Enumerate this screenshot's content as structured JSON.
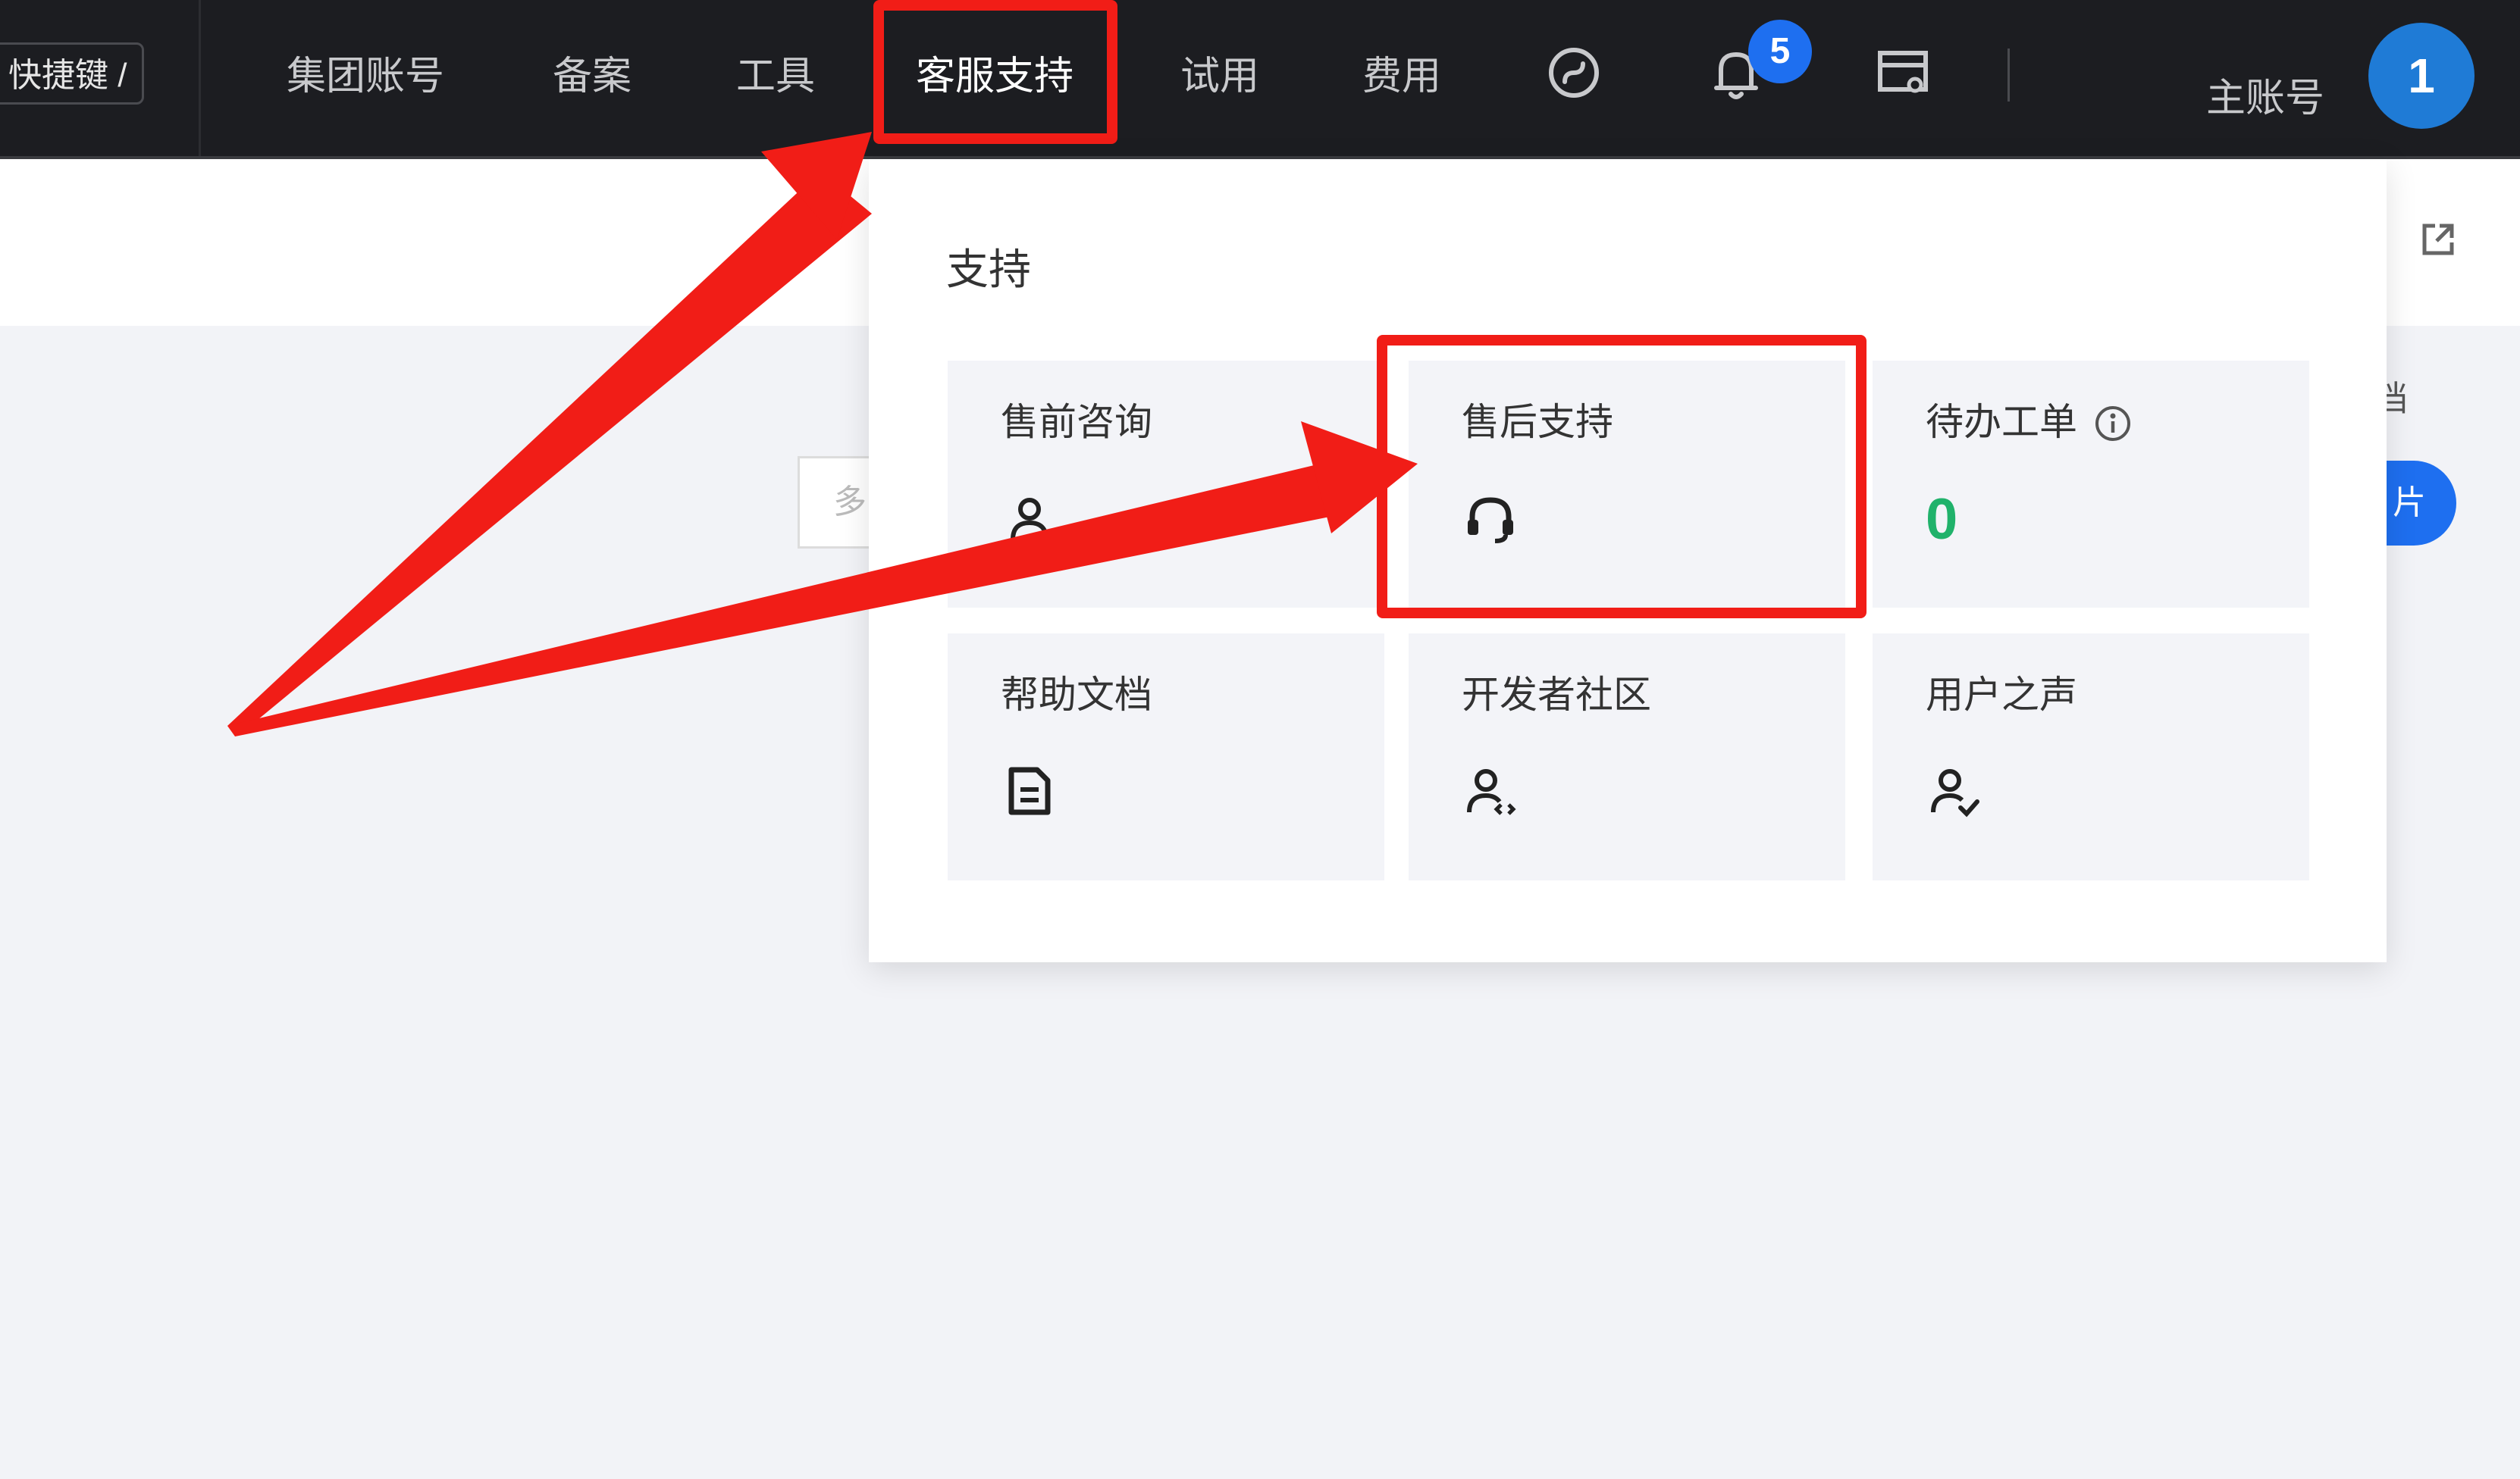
{
  "topbar": {
    "shortcut_label": "快捷键 /",
    "nav": [
      {
        "label": "集团账号"
      },
      {
        "label": "备案"
      },
      {
        "label": "工具"
      },
      {
        "label": "客服支持"
      },
      {
        "label": "试用"
      },
      {
        "label": "费用"
      }
    ],
    "notification_count": "5",
    "account_label": "主账号",
    "avatar_text": "1"
  },
  "header": {
    "doc_fragment": "档"
  },
  "background": {
    "input_placeholder_fragment": "多",
    "blue_button_fragment": "片"
  },
  "support_panel": {
    "title": "支持",
    "cards": [
      {
        "label": "售前咨询",
        "icon": "person-icon"
      },
      {
        "label": "售后支持",
        "icon": "headset-icon"
      },
      {
        "label": "待办工单",
        "icon": "info-icon",
        "value": "0"
      },
      {
        "label": "帮助文档",
        "icon": "document-icon"
      },
      {
        "label": "开发者社区",
        "icon": "developer-community-icon"
      },
      {
        "label": "用户之声",
        "icon": "user-voice-icon"
      }
    ]
  },
  "colors": {
    "topbar_bg": "#1c1d21",
    "highlight_red": "#f11d17",
    "badge_blue": "#1e6ff0",
    "avatar_blue": "#1f7bd6",
    "zero_green": "#20b26b",
    "card_bg": "#f3f4f8"
  }
}
